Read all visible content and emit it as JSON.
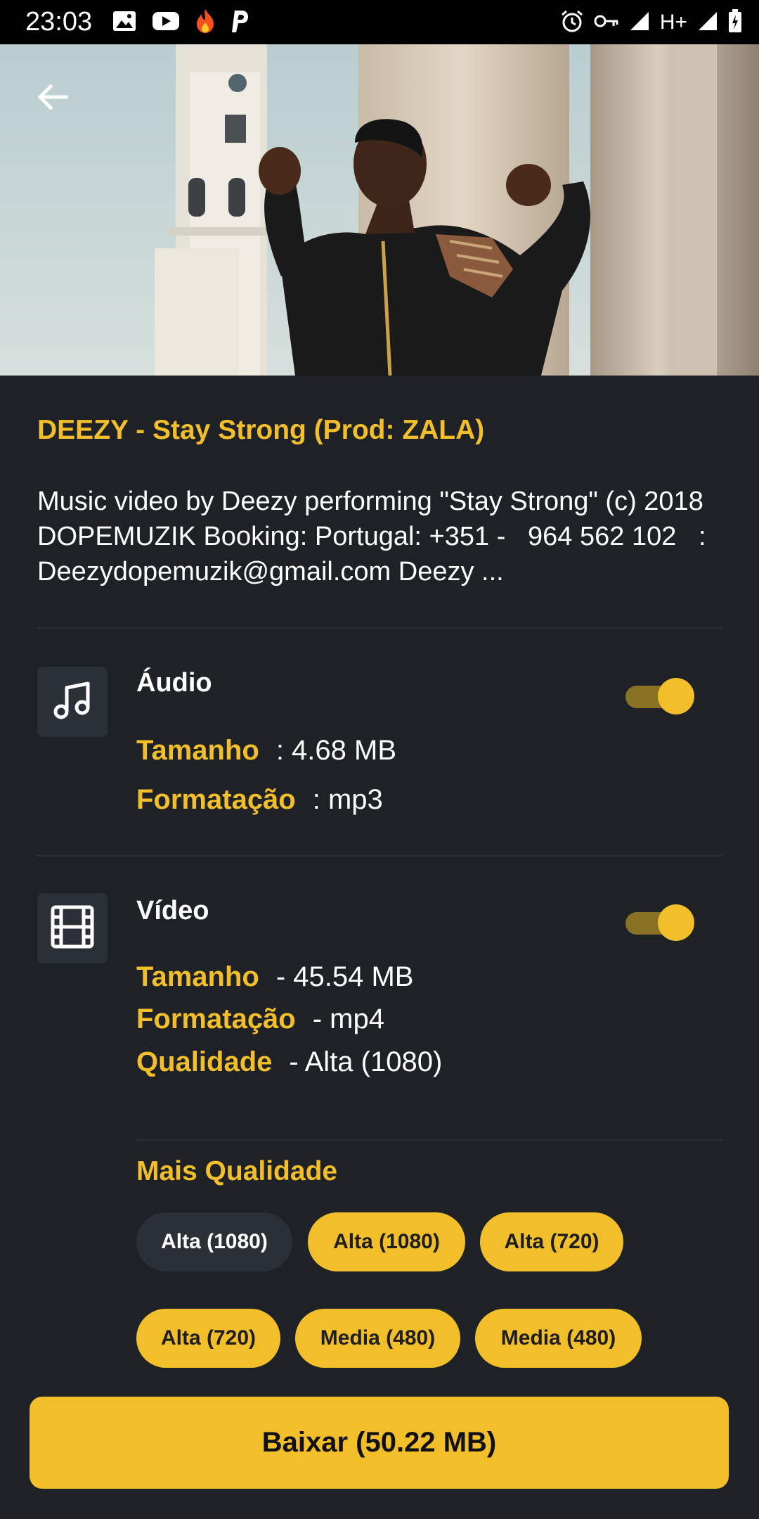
{
  "status_bar": {
    "time": "23:03",
    "network": "H+",
    "icons": [
      "image-icon",
      "youtube-icon",
      "fire-icon",
      "p-icon",
      "alarm-icon",
      "key-icon",
      "signal-icon",
      "battery-icon"
    ]
  },
  "header": {
    "back_icon": "arrow-left-icon"
  },
  "video": {
    "title": "DEEZY - Stay Strong (Prod: ZALA)",
    "description": "Music video by Deezy performing \"Stay Strong\" (c) 2018 DOPEMUZIK Booking: Portugal: +351 -   964 562 102   : Deezydopemuzik@gmail.com Deezy ..."
  },
  "audio": {
    "icon": "music-note-icon",
    "label": "Áudio",
    "size_key": "Tamanho",
    "size_val": ": 4.68 MB",
    "format_key": "Formatação",
    "format_val": ": mp3",
    "enabled": true
  },
  "video_section": {
    "icon": "film-icon",
    "label": "Vídeo",
    "size_key": "Tamanho",
    "size_val": "- 45.54 MB",
    "format_key": "Formatação",
    "format_val": "- mp4",
    "quality_key": "Qualidade",
    "quality_val": "- Alta (1080)",
    "enabled": true
  },
  "more_quality": {
    "label": "Mais Qualidade",
    "options": [
      {
        "label": "Alta (1080)",
        "selected": true
      },
      {
        "label": "Alta (1080)",
        "selected": false
      },
      {
        "label": "Alta (720)",
        "selected": false
      },
      {
        "label": "Alta (720)",
        "selected": false
      },
      {
        "label": "Media (480)",
        "selected": false
      },
      {
        "label": "Media (480)",
        "selected": false
      }
    ]
  },
  "download": {
    "label": "Baixar (50.22 MB)"
  },
  "colors": {
    "accent": "#f2bf2a",
    "background": "#1e2126",
    "surface": "#2b2f36"
  }
}
